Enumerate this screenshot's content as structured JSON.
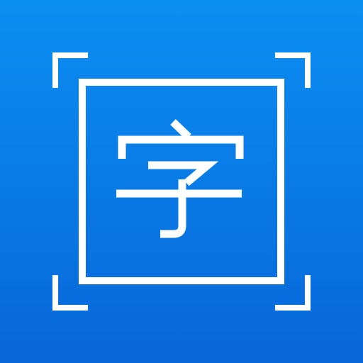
{
  "icon": {
    "name": "text-scanner-app-icon",
    "background_top_color": "#0a8ff3",
    "background_bottom_color": "#0866d9",
    "foreground_color": "#ffffff",
    "glyph_name": "zi-character-icon",
    "frame_name": "scan-frame-icon"
  }
}
